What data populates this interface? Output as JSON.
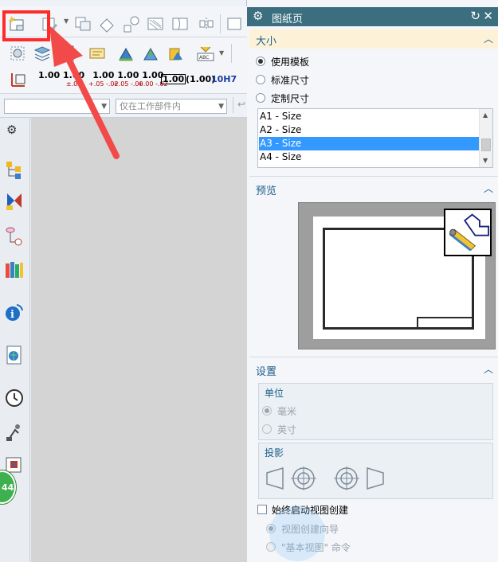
{
  "toolbar": {
    "tolerance_items": [
      {
        "main": "1.00",
        "tol": ""
      },
      {
        "main": "1.00",
        "tol": "±.05"
      },
      {
        "main": "1.00",
        "tol": "+.05 -.02"
      },
      {
        "main": "1.00",
        "tol": "+.05 -.00"
      },
      {
        "main": "1.00",
        "tol": "+.00 -.02"
      },
      {
        "main": "1.00",
        "tol": ""
      },
      {
        "main": "(1.00)",
        "tol": ""
      },
      {
        "main": "10H7",
        "tol": ""
      }
    ]
  },
  "filters": {
    "type_filter": "",
    "scope_filter": "仅在工作部件内"
  },
  "side_badge": "44",
  "dialog": {
    "title": "图纸页",
    "size_group": {
      "title": "大小",
      "options": [
        "使用模板",
        "标准尺寸",
        "定制尺寸"
      ],
      "selected_option": "使用模板",
      "sizes": [
        "A1 - Size",
        "A2 - Size",
        "A3 - Size",
        "A4 - Size"
      ],
      "selected_size": "A3 - Size"
    },
    "preview_group": {
      "title": "预览"
    },
    "settings_group": {
      "title": "设置",
      "units_label": "单位",
      "units": [
        "毫米",
        "英寸"
      ],
      "selected_unit": "毫米",
      "projection_label": "投影",
      "auto_view_label": "始终启动视图创建",
      "auto_view_checked": false,
      "view_options": [
        "视图创建向导",
        "\"基本视图\" 命令"
      ],
      "selected_view_option": "视图创建向导"
    }
  },
  "colors": {
    "title_bar": "#3b6e7e",
    "group_header_text": "#1f5e8a",
    "selection": "#3399ff",
    "highlight": "#ff2b2b"
  }
}
